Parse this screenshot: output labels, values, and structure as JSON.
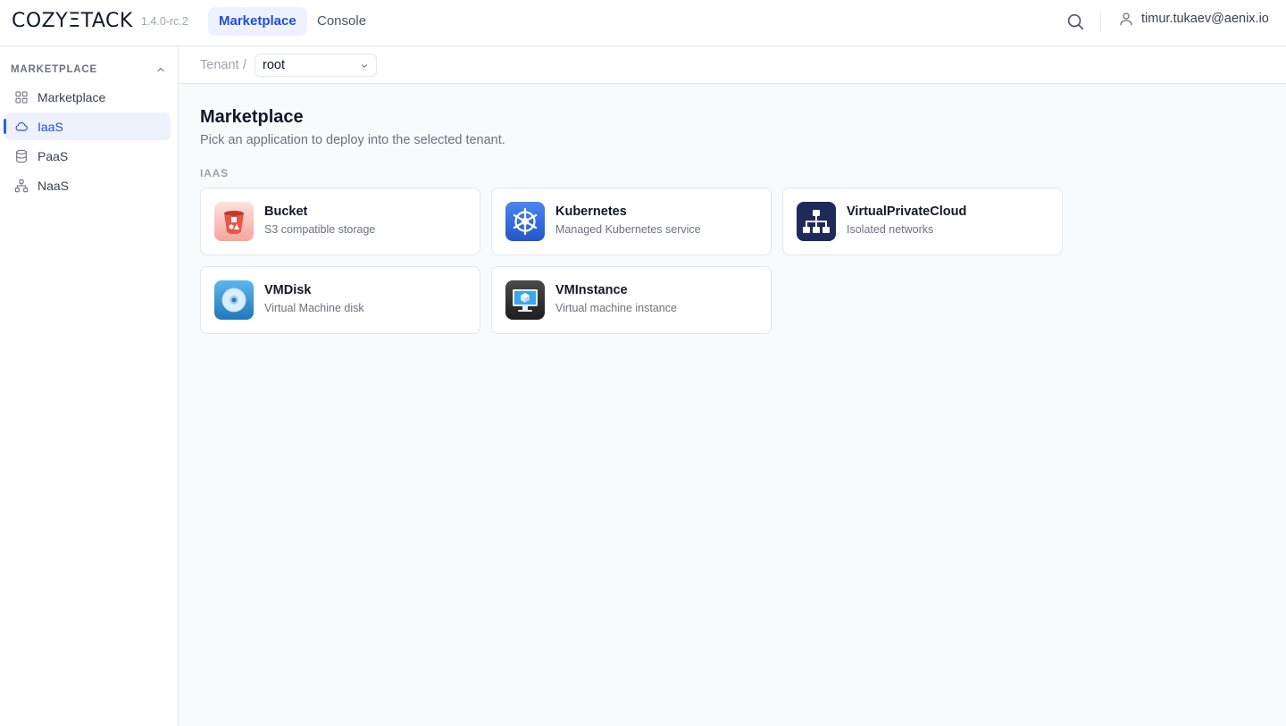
{
  "header": {
    "logo": "COZYΞTACK",
    "version": "1.4.0-rc.2",
    "tabs": [
      {
        "label": "Marketplace"
      },
      {
        "label": "Console"
      }
    ],
    "user": "timur.tukaev@aenix.io"
  },
  "sidebar": {
    "section_label": "MARKETPLACE",
    "items": [
      {
        "label": "Marketplace",
        "icon": "grid-icon"
      },
      {
        "label": "IaaS",
        "icon": "cloud-icon"
      },
      {
        "label": "PaaS",
        "icon": "database-icon"
      },
      {
        "label": "NaaS",
        "icon": "network-icon"
      }
    ]
  },
  "breadcrumb": {
    "label": "Tenant",
    "separator": "/",
    "tenant": "root"
  },
  "main": {
    "title": "Marketplace",
    "subtitle": "Pick an application to deploy into the selected tenant.",
    "section": "IAAS",
    "cards": [
      {
        "name": "Bucket",
        "description": "S3 compatible storage",
        "icon": "bucket-icon",
        "color": "#e4574b"
      },
      {
        "name": "Kubernetes",
        "description": "Managed Kubernetes service",
        "icon": "kubernetes-icon",
        "color": "#326ce5"
      },
      {
        "name": "VirtualPrivateCloud",
        "description": "Isolated networks",
        "icon": "network-tree-icon",
        "color": "#1e2a5a"
      },
      {
        "name": "VMDisk",
        "description": "Virtual Machine disk",
        "icon": "disk-icon",
        "color": "#2f8fd0"
      },
      {
        "name": "VMInstance",
        "description": "Virtual machine instance",
        "icon": "monitor-icon",
        "color": "#2d2d2d"
      }
    ]
  },
  "colors": {
    "accent": "#1d4ed8",
    "accent_bg": "#eef2ff"
  }
}
